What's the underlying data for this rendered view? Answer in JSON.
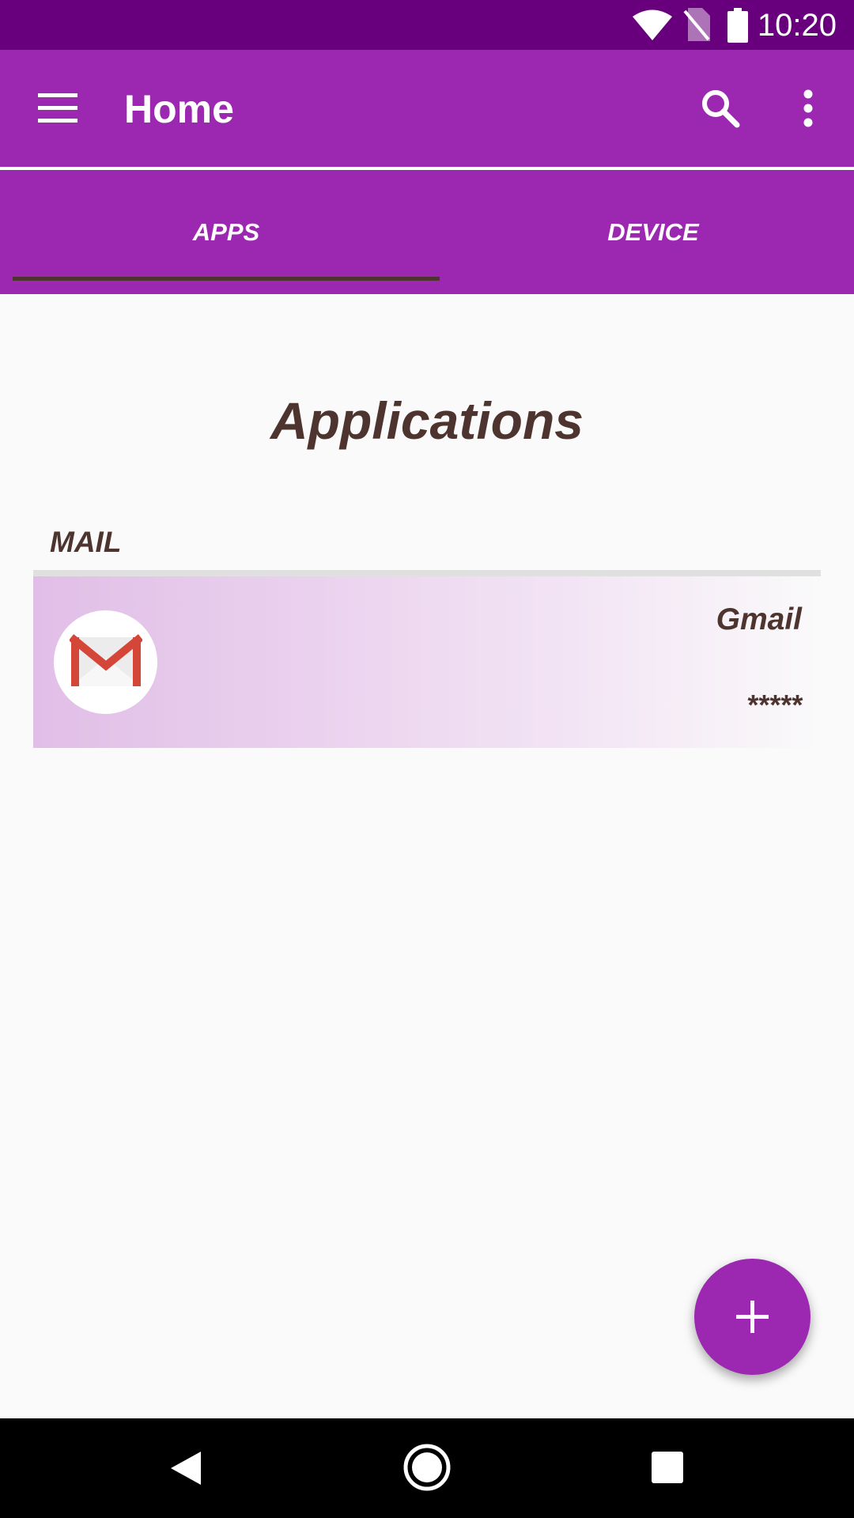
{
  "status_bar": {
    "time": "10:20",
    "icons": [
      "wifi-icon",
      "no-sim-icon",
      "battery-icon"
    ]
  },
  "app_bar": {
    "title": "Home",
    "icons": [
      "menu-icon",
      "search-icon",
      "more-vert-icon"
    ]
  },
  "tabs": [
    {
      "label": "APPS",
      "selected": true
    },
    {
      "label": "DEVICE",
      "selected": false
    }
  ],
  "main": {
    "heading": "Applications",
    "sections": [
      {
        "label": "MAIL",
        "items": [
          {
            "name": "Gmail",
            "password": "*****",
            "icon": "gmail-icon"
          }
        ]
      }
    ]
  },
  "fab": {
    "icon": "plus-icon"
  },
  "nav_bar": {
    "icons": [
      "back-icon",
      "home-icon",
      "recents-icon"
    ]
  },
  "colors": {
    "primary": "#9c27b0",
    "primary_dark": "#68007d",
    "text_brown": "#4e342e",
    "card_start": "#e1bee7"
  }
}
